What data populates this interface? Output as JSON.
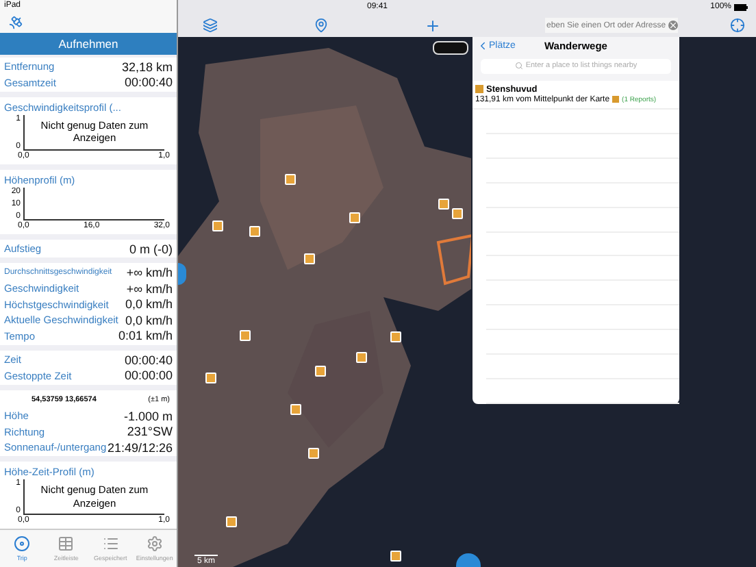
{
  "status_bar": {
    "device": "iPad",
    "time": "09:41",
    "battery": "100%"
  },
  "sidebar": {
    "record_button": "Aufnehmen",
    "sections": [
      {
        "kind": "stats",
        "rows": [
          {
            "label": "Entfernung",
            "value": "32,18 km",
            "small": false
          },
          {
            "label": "Gesamtzeit",
            "value": "00:00:40",
            "small": false
          }
        ]
      },
      {
        "kind": "chart",
        "title": "Geschwindigkeitsprofil (...",
        "message": "Nicht genug Daten zum Anzeigen",
        "y_ticks": [
          "1",
          "0"
        ],
        "x_ticks": [
          "0,0",
          "1,0"
        ]
      },
      {
        "kind": "chart",
        "title": "Höhenprofil (m)",
        "y_ticks": [
          "20",
          "10",
          "0"
        ],
        "x_ticks": [
          "0,0",
          "16,0",
          "32,0"
        ]
      },
      {
        "kind": "stats",
        "rows": [
          {
            "label": "Aufstieg",
            "value": "0 m (-0)",
            "small": false
          }
        ]
      },
      {
        "kind": "stats",
        "rows": [
          {
            "label": "Durchschnittsgeschwindigkeit",
            "value": "+∞ km/h",
            "small": true
          },
          {
            "label": "Geschwindigkeit",
            "value": "+∞ km/h",
            "small": false
          },
          {
            "label": "Höchstgeschwindigkeit",
            "value": "0,0 km/h",
            "small": false
          },
          {
            "label": "Aktuelle Geschwindigkeit",
            "value": "0,0 km/h",
            "small": false
          },
          {
            "label": "Tempo",
            "value": "0:01 km/h",
            "small": false
          }
        ]
      },
      {
        "kind": "stats",
        "rows": [
          {
            "label": "Zeit",
            "value": "00:00:40",
            "small": false
          },
          {
            "label": "Gestoppte Zeit",
            "value": "00:00:00",
            "small": false
          }
        ]
      },
      {
        "kind": "position",
        "coordinates": "54,53759 13,66574",
        "accuracy": "(±1 m)",
        "rows": [
          {
            "label": "Höhe",
            "value": "-1.000 m",
            "small": false
          },
          {
            "label": "Richtung",
            "value": "231°SW",
            "small": false
          },
          {
            "label": "Sonnenauf-/untergang",
            "value": "21:49/12:26",
            "small": false
          }
        ]
      },
      {
        "kind": "chart",
        "title": "Höhe-Zeit-Profil (m)",
        "message": "Nicht genug Daten zum Anzeigen",
        "y_ticks": [
          "1",
          "0"
        ],
        "x_ticks": [
          "0,0",
          "1,0"
        ]
      }
    ]
  },
  "tab_bar": {
    "tabs": [
      {
        "label": "Trip",
        "selected": true
      },
      {
        "label": "Zeitleiste",
        "selected": false
      },
      {
        "label": "Gespeichert",
        "selected": false
      },
      {
        "label": "Einstellungen",
        "selected": false
      }
    ]
  },
  "map": {
    "search": {
      "placeholder": "eben Sie einen Ort oder Adresse"
    },
    "scale": "5 km",
    "popover": {
      "back": "Plätze",
      "title": "Wanderwege",
      "search_placeholder": "Enter a place to list things nearby",
      "results": [
        {
          "name": "Stenshuvud",
          "detail": "131,91 km vom Mittelpunkt der Karte",
          "reports": "(1 Reports)"
        }
      ]
    }
  }
}
